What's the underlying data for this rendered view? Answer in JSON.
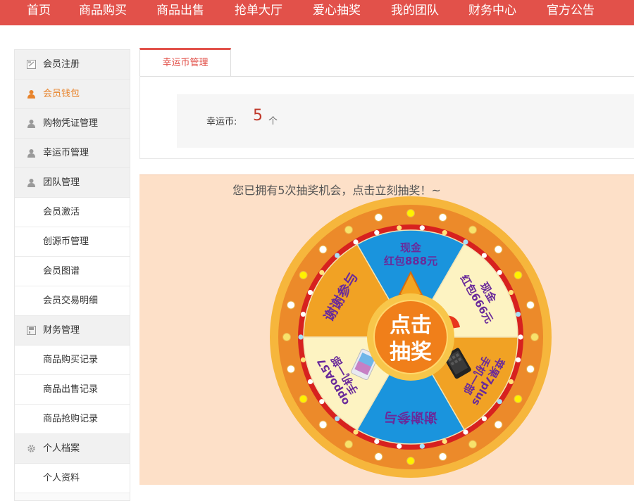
{
  "topnav": {
    "items": [
      "首页",
      "商品购买",
      "商品出售",
      "抢单大厅",
      "爱心抽奖",
      "我的团队",
      "财务中心",
      "官方公告"
    ]
  },
  "sidebar": {
    "items": [
      {
        "label": "会员注册",
        "icon": "register-icon"
      },
      {
        "label": "会员钱包",
        "icon": "user-icon"
      },
      {
        "label": "购物凭证管理",
        "icon": "user-icon"
      },
      {
        "label": "幸运币管理",
        "icon": "user-icon"
      },
      {
        "label": "团队管理",
        "icon": "user-icon"
      },
      {
        "label": "会员激活"
      },
      {
        "label": "创源币管理"
      },
      {
        "label": "会员图谱"
      },
      {
        "label": "会员交易明细"
      },
      {
        "label": "财务管理",
        "icon": "finance-icon"
      },
      {
        "label": "商品购买记录"
      },
      {
        "label": "商品出售记录"
      },
      {
        "label": "商品抢购记录"
      },
      {
        "label": "个人档案",
        "icon": "gear-icon"
      },
      {
        "label": "个人资料"
      }
    ]
  },
  "tab": {
    "label": "幸运币管理"
  },
  "coin": {
    "label": "幸运币:",
    "value": "5",
    "unit": "个"
  },
  "lottery": {
    "title": "您已拥有5次抽奖机会，点击立刻抽奖！~",
    "center_line1": "点击",
    "center_line2": "抽奖",
    "prizes": [
      {
        "line1": "现金",
        "line2": "红包888元"
      },
      {
        "line1": "现金",
        "line2": "红包666元"
      },
      {
        "line1": "苹果7plus",
        "line2": "手机一部"
      },
      {
        "line1": "谢谢参与",
        "line2": ""
      },
      {
        "line1": "oppoA57",
        "line2": "手机一部"
      },
      {
        "line1": "谢谢参与",
        "line2": ""
      }
    ]
  },
  "colors": {
    "brand_red": "#e2514a",
    "active_orange": "#e8842c",
    "wheel_blue": "#1a94dd",
    "wheel_cream": "#fdf3c2",
    "wheel_orange": "#f1a224",
    "wheel_red_ring": "#d7211f",
    "prize_text": "#6a2a9a"
  }
}
